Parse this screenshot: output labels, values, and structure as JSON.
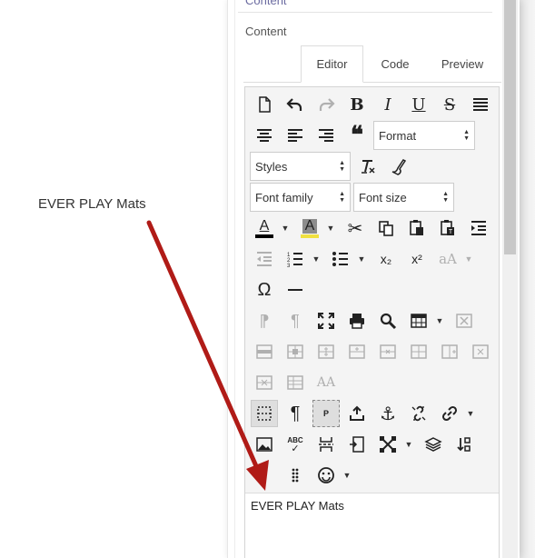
{
  "annotation": {
    "text": "EVER PLAY Mats",
    "arrow_color": "#b01b17"
  },
  "panel": {
    "section_top_label": "Content",
    "section_label": "Content"
  },
  "tabs": [
    {
      "label": "Editor",
      "active": true
    },
    {
      "label": "Code",
      "active": false
    },
    {
      "label": "Preview",
      "active": false
    }
  ],
  "toolbar": {
    "format_select": "Format",
    "styles_select": "Styles",
    "font_family_select": "Font family",
    "font_size_select": "Font size",
    "icons": [
      "new-document-icon",
      "undo-icon",
      "redo-icon",
      "bold-icon",
      "italic-icon",
      "underline-icon",
      "strikethrough-icon",
      "align-justify-icon",
      "align-center-icon",
      "align-left-icon",
      "align-right-icon",
      "blockquote-icon",
      "clear-formatting-icon",
      "format-painter-icon",
      "text-color-icon",
      "background-color-icon",
      "cut-icon",
      "copy-icon",
      "paste-icon",
      "paste-text-icon",
      "indent-icon",
      "outdent-icon",
      "numbered-list-icon",
      "bullet-list-icon",
      "subscript-icon",
      "superscript-icon",
      "font-case-icon",
      "special-character-icon",
      "horizontal-line-icon",
      "ltr-icon",
      "rtl-icon",
      "fullscreen-icon",
      "print-icon",
      "search-icon",
      "table-icon",
      "delete-table-icon",
      "table-cell-props-icon",
      "table-merge-cells-icon",
      "table-split-cell-icon",
      "table-insert-row-before-icon",
      "table-delete-row-icon",
      "table-insert-col-before-icon",
      "table-insert-col-after-icon",
      "table-delete-col-icon",
      "table-row-props-icon",
      "table-props-icon",
      "change-case-icon",
      "visual-blocks-icon",
      "show-invisibles-icon",
      "visual-paragraph-icon",
      "insert-after-icon",
      "anchor-icon",
      "unlink-icon",
      "link-icon",
      "image-icon",
      "spellcheck-icon",
      "page-break-icon",
      "template-icon",
      "bootstrap-icon",
      "layers-icon",
      "sort-icon",
      "drag-handle-icon",
      "emoticons-icon"
    ],
    "glyphs": {
      "bold": "B",
      "italic": "I",
      "underline": "U",
      "strike": "S",
      "text_color": "A",
      "bg_color": "A",
      "subscript": "x₂",
      "superscript": "x²",
      "font_case": "aA",
      "omega": "Ω",
      "change_case": "AA",
      "abc": "ABC"
    },
    "text_color_bar": "#000000",
    "bg_color_bar": "#f0e040"
  },
  "editor": {
    "content": "EVER PLAY Mats"
  }
}
